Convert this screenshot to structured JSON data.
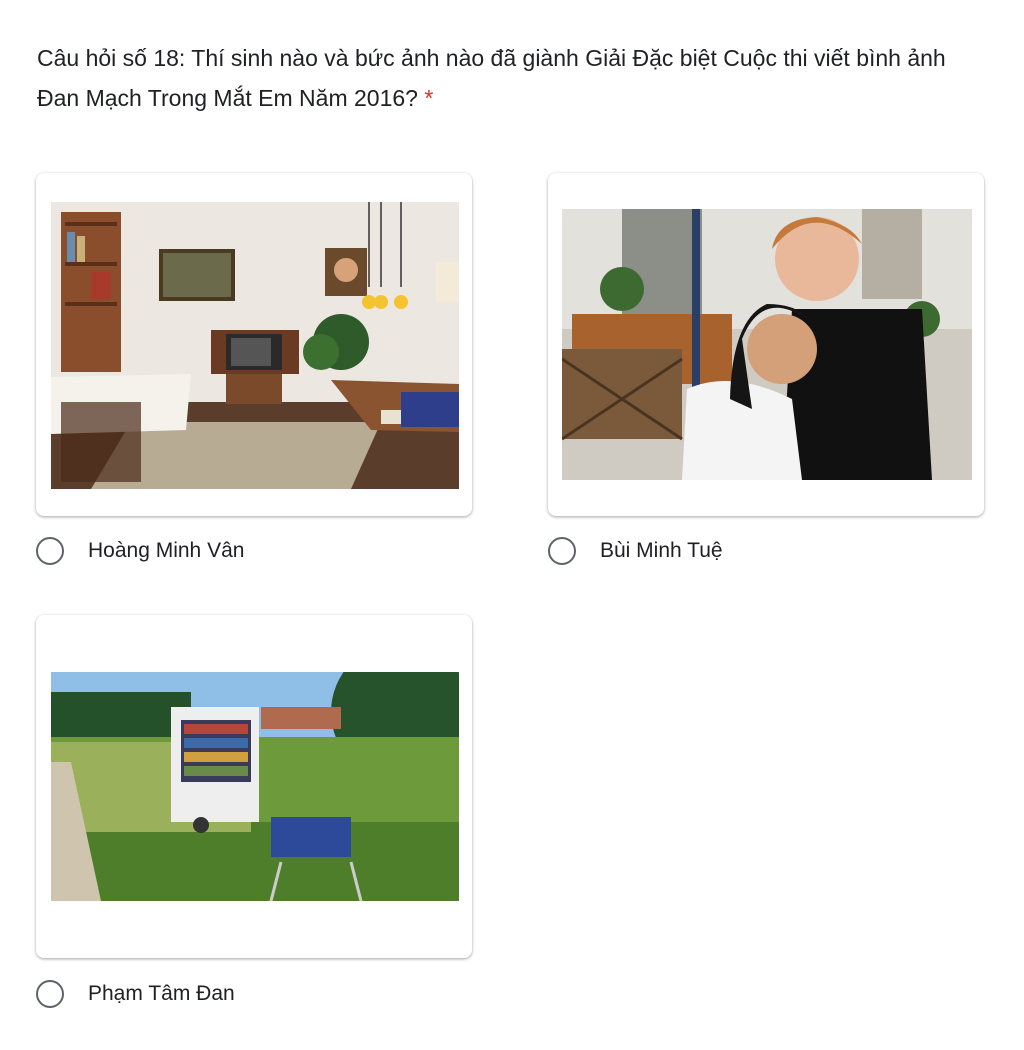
{
  "question": {
    "text": "Câu hỏi số 18: Thí sinh nào và bức ảnh nào đã giành Giải Đặc biệt Cuộc thi viết bình ảnh Đan Mạch Trong Mắt Em Năm 2016?",
    "required_marker": "*",
    "required_color": "#d93025"
  },
  "options": [
    {
      "label": "Hoàng Minh Vân",
      "image": "living-room-photo",
      "selected": false
    },
    {
      "label": "Bùi Minh Tuệ",
      "image": "couple-hug-photo",
      "selected": false
    },
    {
      "label": "Phạm Tâm Đan",
      "image": "book-cart-field-photo",
      "selected": false
    }
  ]
}
